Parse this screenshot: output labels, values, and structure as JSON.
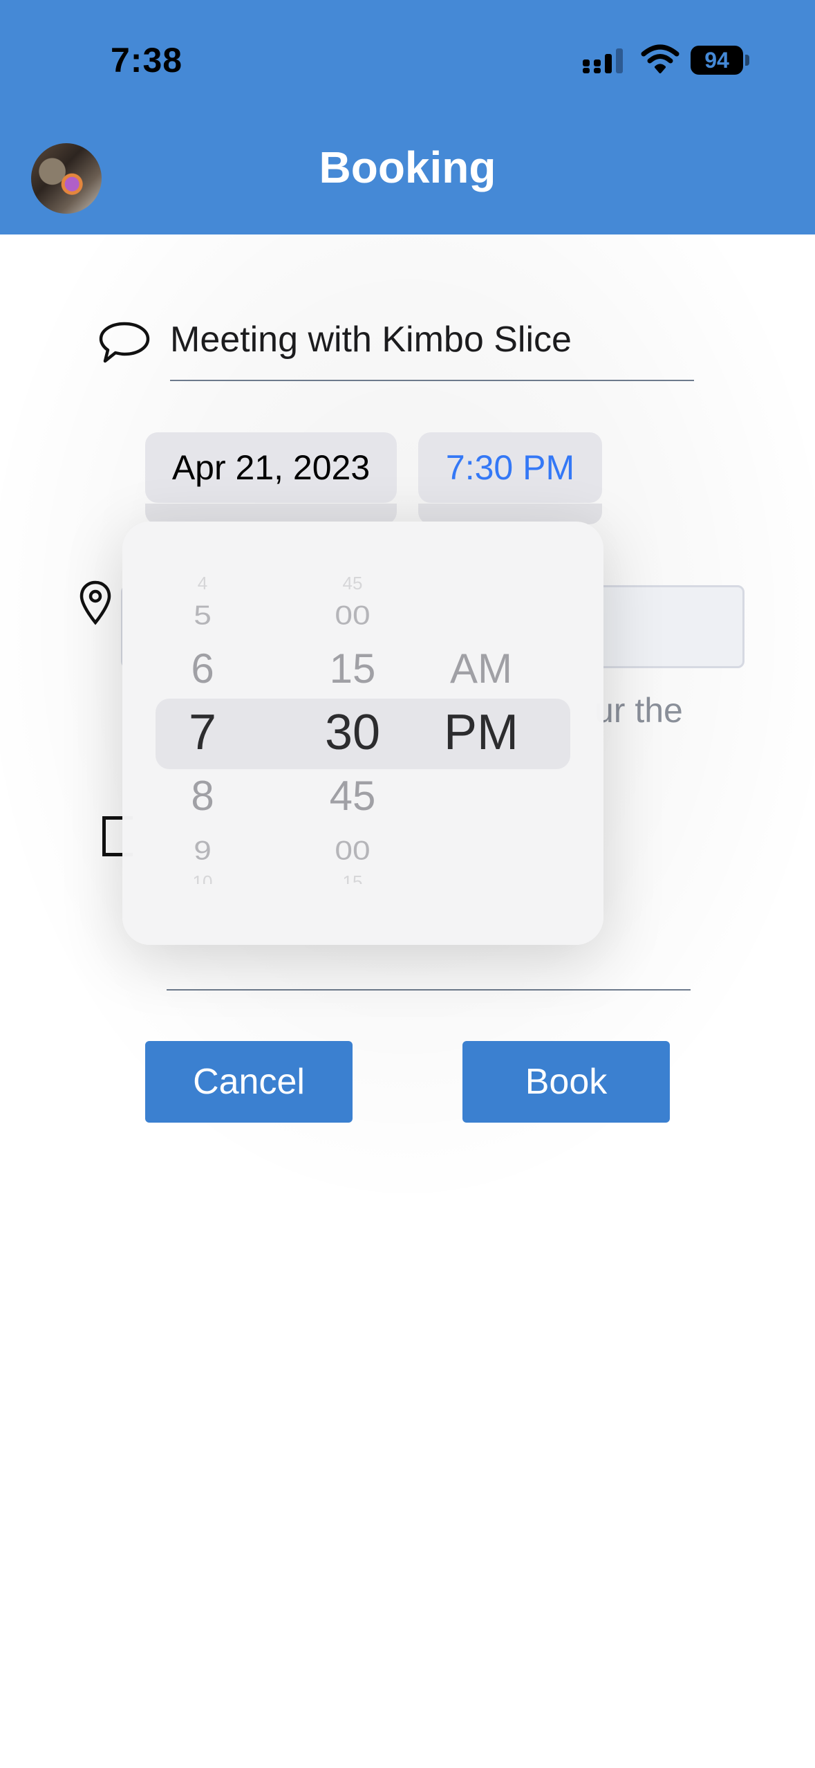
{
  "status_bar": {
    "time": "7:38",
    "battery": "94",
    "icons": [
      "signal-icon",
      "wifi-icon",
      "battery-icon"
    ]
  },
  "header": {
    "title": "Booking",
    "avatar": "user-avatar"
  },
  "form": {
    "title_value": "Meeting with Kimbo Slice",
    "date_value": "Apr 21, 2023",
    "time_value": "7:30 PM",
    "helper_text": "ur the"
  },
  "time_picker": {
    "hours": [
      "4",
      "5",
      "6",
      "7",
      "8",
      "9",
      "10"
    ],
    "minutes": [
      "45",
      "00",
      "15",
      "30",
      "45",
      "00",
      "15"
    ],
    "periods": [
      "AM",
      "PM"
    ],
    "selected": {
      "hour": "7",
      "minute": "30",
      "period": "PM"
    }
  },
  "buttons": {
    "cancel_label": "Cancel",
    "book_label": "Book"
  },
  "colors": {
    "header_bg": "#4589d6",
    "accent": "#3478f6",
    "button_bg": "#3b80d0"
  }
}
